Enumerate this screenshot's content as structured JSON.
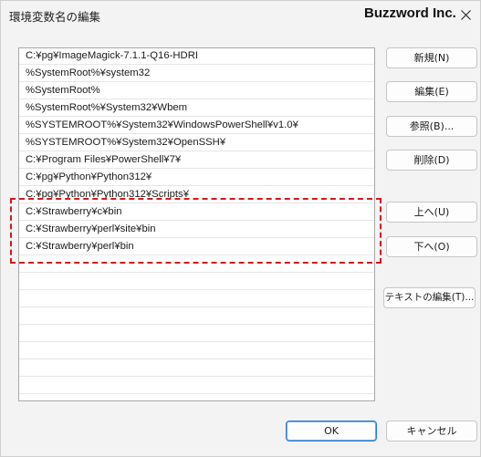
{
  "window": {
    "title": "環境変数名の編集",
    "brand": "Buzzword Inc."
  },
  "path_list": [
    "C:¥pg¥ImageMagick-7.1.1-Q16-HDRI",
    "%SystemRoot%¥system32",
    "%SystemRoot%",
    "%SystemRoot%¥System32¥Wbem",
    "%SYSTEMROOT%¥System32¥WindowsPowerShell¥v1.0¥",
    "%SYSTEMROOT%¥System32¥OpenSSH¥",
    "C:¥Program Files¥PowerShell¥7¥",
    "C:¥pg¥Python¥Python312¥",
    "C:¥pg¥Python¥Python312¥Scripts¥",
    "C:¥Strawberry¥c¥bin",
    "C:¥Strawberry¥perl¥site¥bin",
    "C:¥Strawberry¥perl¥bin"
  ],
  "buttons": {
    "new": "新規(N)",
    "edit": "編集(E)",
    "browse": "参照(B)...",
    "delete": "削除(D)",
    "move_up": "上へ(U)",
    "move_down": "下へ(O)",
    "edit_text": "テキストの編集(T)...",
    "ok": "OK",
    "cancel": "キャンセル"
  },
  "icons": {
    "close": "close-icon"
  },
  "colors": {
    "highlight": "#d6171f",
    "ok_border": "#2d7bd3"
  }
}
